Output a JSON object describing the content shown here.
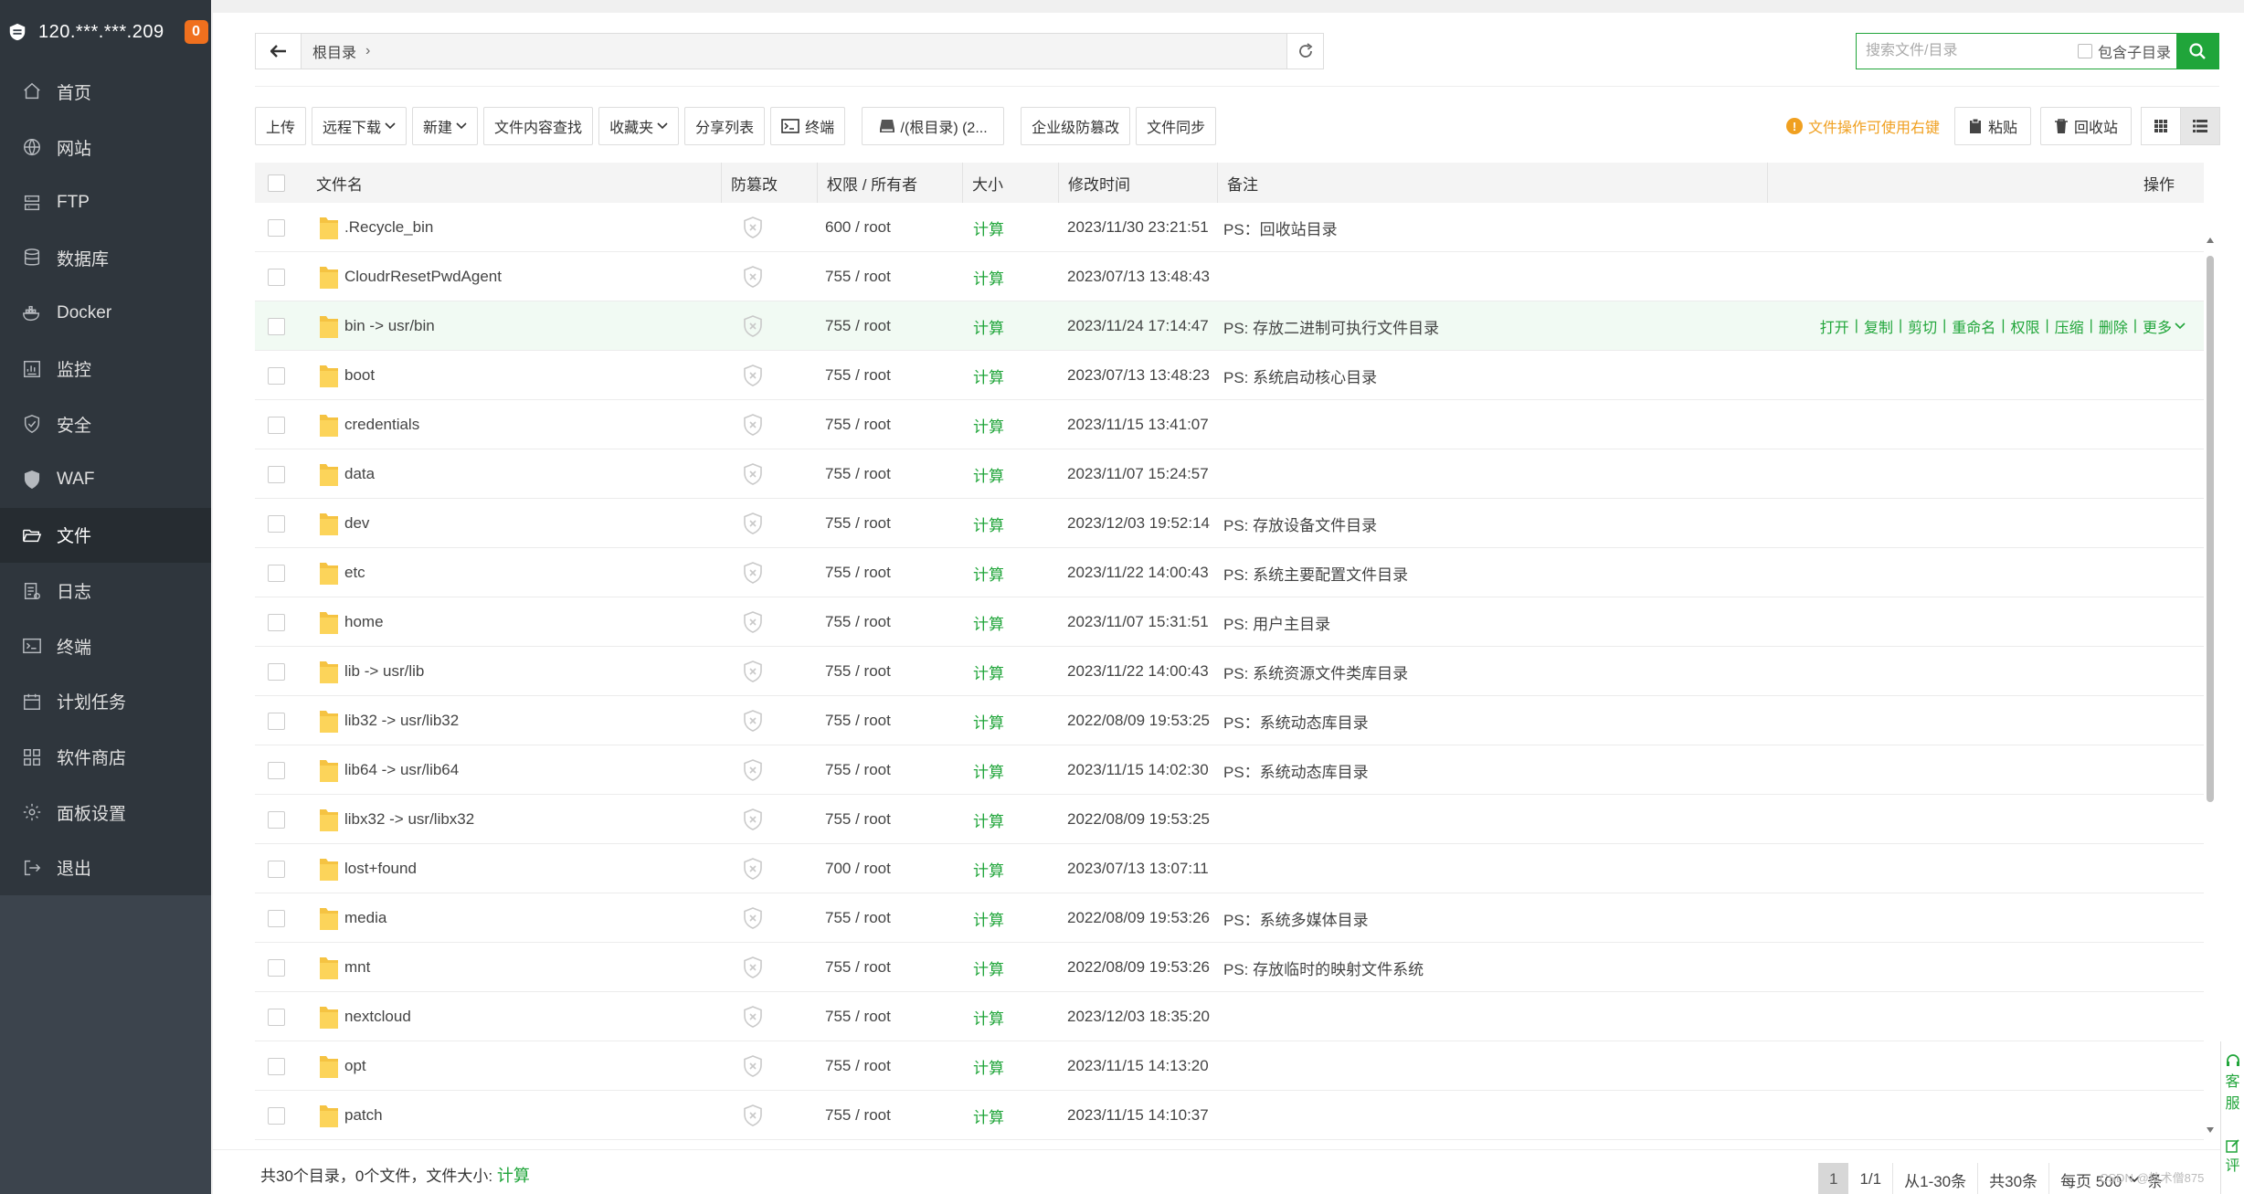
{
  "sidebar": {
    "server_ip": "120.***.***.209",
    "badge": "0",
    "items": [
      {
        "label": "首页",
        "icon": "home-icon"
      },
      {
        "label": "网站",
        "icon": "globe-icon"
      },
      {
        "label": "FTP",
        "icon": "ftp-icon"
      },
      {
        "label": "数据库",
        "icon": "database-icon"
      },
      {
        "label": "Docker",
        "icon": "docker-icon"
      },
      {
        "label": "监控",
        "icon": "monitor-icon"
      },
      {
        "label": "安全",
        "icon": "shield-check-icon"
      },
      {
        "label": "WAF",
        "icon": "waf-shield-icon"
      },
      {
        "label": "文件",
        "icon": "folder-open-icon",
        "active": true
      },
      {
        "label": "日志",
        "icon": "log-icon"
      },
      {
        "label": "终端",
        "icon": "terminal-icon"
      },
      {
        "label": "计划任务",
        "icon": "calendar-icon"
      },
      {
        "label": "软件商店",
        "icon": "apps-icon"
      },
      {
        "label": "面板设置",
        "icon": "gear-icon"
      },
      {
        "label": "退出",
        "icon": "logout-icon"
      }
    ]
  },
  "address": {
    "path": "根目录"
  },
  "search": {
    "placeholder": "搜索文件/目录",
    "subdir_label": "包含子目录"
  },
  "toolbar": {
    "upload": "上传",
    "remote_download": "远程下载",
    "new": "新建",
    "content_search": "文件内容查找",
    "favorites": "收藏夹",
    "share_list": "分享列表",
    "terminal": "终端",
    "disk": "/(根目录) (2...",
    "tamper": "企业级防篡改",
    "sync": "文件同步",
    "tip": "文件操作可使用右键",
    "paste": "粘贴",
    "recycle": "回收站"
  },
  "table": {
    "headers": {
      "name": "文件名",
      "tamper": "防篡改",
      "perm": "权限 / 所有者",
      "size": "大小",
      "mtime": "修改时间",
      "note": "备注",
      "ops": "操作"
    },
    "rows": [
      {
        "name": ".Recycle_bin",
        "perm": "600 / root",
        "size": "计算",
        "mtime": "2023/11/30 23:21:51",
        "note": "PS：回收站目录"
      },
      {
        "name": "CloudrResetPwdAgent",
        "perm": "755 / root",
        "size": "计算",
        "mtime": "2023/07/13 13:48:43",
        "note": ""
      },
      {
        "name": "bin -> usr/bin",
        "perm": "755 / root",
        "size": "计算",
        "mtime": "2023/11/24 17:14:47",
        "note": "PS: 存放二进制可执行文件目录"
      },
      {
        "name": "boot",
        "perm": "755 / root",
        "size": "计算",
        "mtime": "2023/07/13 13:48:23",
        "note": "PS: 系统启动核心目录"
      },
      {
        "name": "credentials",
        "perm": "755 / root",
        "size": "计算",
        "mtime": "2023/11/15 13:41:07",
        "note": ""
      },
      {
        "name": "data",
        "perm": "755 / root",
        "size": "计算",
        "mtime": "2023/11/07 15:24:57",
        "note": ""
      },
      {
        "name": "dev",
        "perm": "755 / root",
        "size": "计算",
        "mtime": "2023/12/03 19:52:14",
        "note": "PS: 存放设备文件目录"
      },
      {
        "name": "etc",
        "perm": "755 / root",
        "size": "计算",
        "mtime": "2023/11/22 14:00:43",
        "note": "PS: 系统主要配置文件目录"
      },
      {
        "name": "home",
        "perm": "755 / root",
        "size": "计算",
        "mtime": "2023/11/07 15:31:51",
        "note": "PS: 用户主目录"
      },
      {
        "name": "lib -> usr/lib",
        "perm": "755 / root",
        "size": "计算",
        "mtime": "2023/11/22 14:00:43",
        "note": "PS: 系统资源文件类库目录"
      },
      {
        "name": "lib32 -> usr/lib32",
        "perm": "755 / root",
        "size": "计算",
        "mtime": "2022/08/09 19:53:25",
        "note": "PS：系统动态库目录"
      },
      {
        "name": "lib64 -> usr/lib64",
        "perm": "755 / root",
        "size": "计算",
        "mtime": "2023/11/15 14:02:30",
        "note": "PS：系统动态库目录"
      },
      {
        "name": "libx32 -> usr/libx32",
        "perm": "755 / root",
        "size": "计算",
        "mtime": "2022/08/09 19:53:25",
        "note": ""
      },
      {
        "name": "lost+found",
        "perm": "700 / root",
        "size": "计算",
        "mtime": "2023/07/13 13:07:11",
        "note": ""
      },
      {
        "name": "media",
        "perm": "755 / root",
        "size": "计算",
        "mtime": "2022/08/09 19:53:26",
        "note": "PS：系统多媒体目录"
      },
      {
        "name": "mnt",
        "perm": "755 / root",
        "size": "计算",
        "mtime": "2022/08/09 19:53:26",
        "note": "PS: 存放临时的映射文件系统"
      },
      {
        "name": "nextcloud",
        "perm": "755 / root",
        "size": "计算",
        "mtime": "2023/12/03 18:35:20",
        "note": ""
      },
      {
        "name": "opt",
        "perm": "755 / root",
        "size": "计算",
        "mtime": "2023/11/15 14:13:20",
        "note": ""
      },
      {
        "name": "patch",
        "perm": "755 / root",
        "size": "计算",
        "mtime": "2023/11/15 14:10:37",
        "note": ""
      }
    ],
    "row_ops": [
      "打开",
      "复制",
      "剪切",
      "重命名",
      "权限",
      "压缩",
      "删除",
      "更多"
    ]
  },
  "footer": {
    "summary": "共30个目录，0个文件，文件大小:",
    "calc": "计算",
    "page": "1",
    "pages": "1/1",
    "range": "从1-30条",
    "total": "共30条",
    "per_page": "每页 500",
    "unit": "条"
  },
  "corner": {
    "text1": "客",
    "text2": "服",
    "text3": "评"
  },
  "watermark": "CSDN @技术僧875"
}
